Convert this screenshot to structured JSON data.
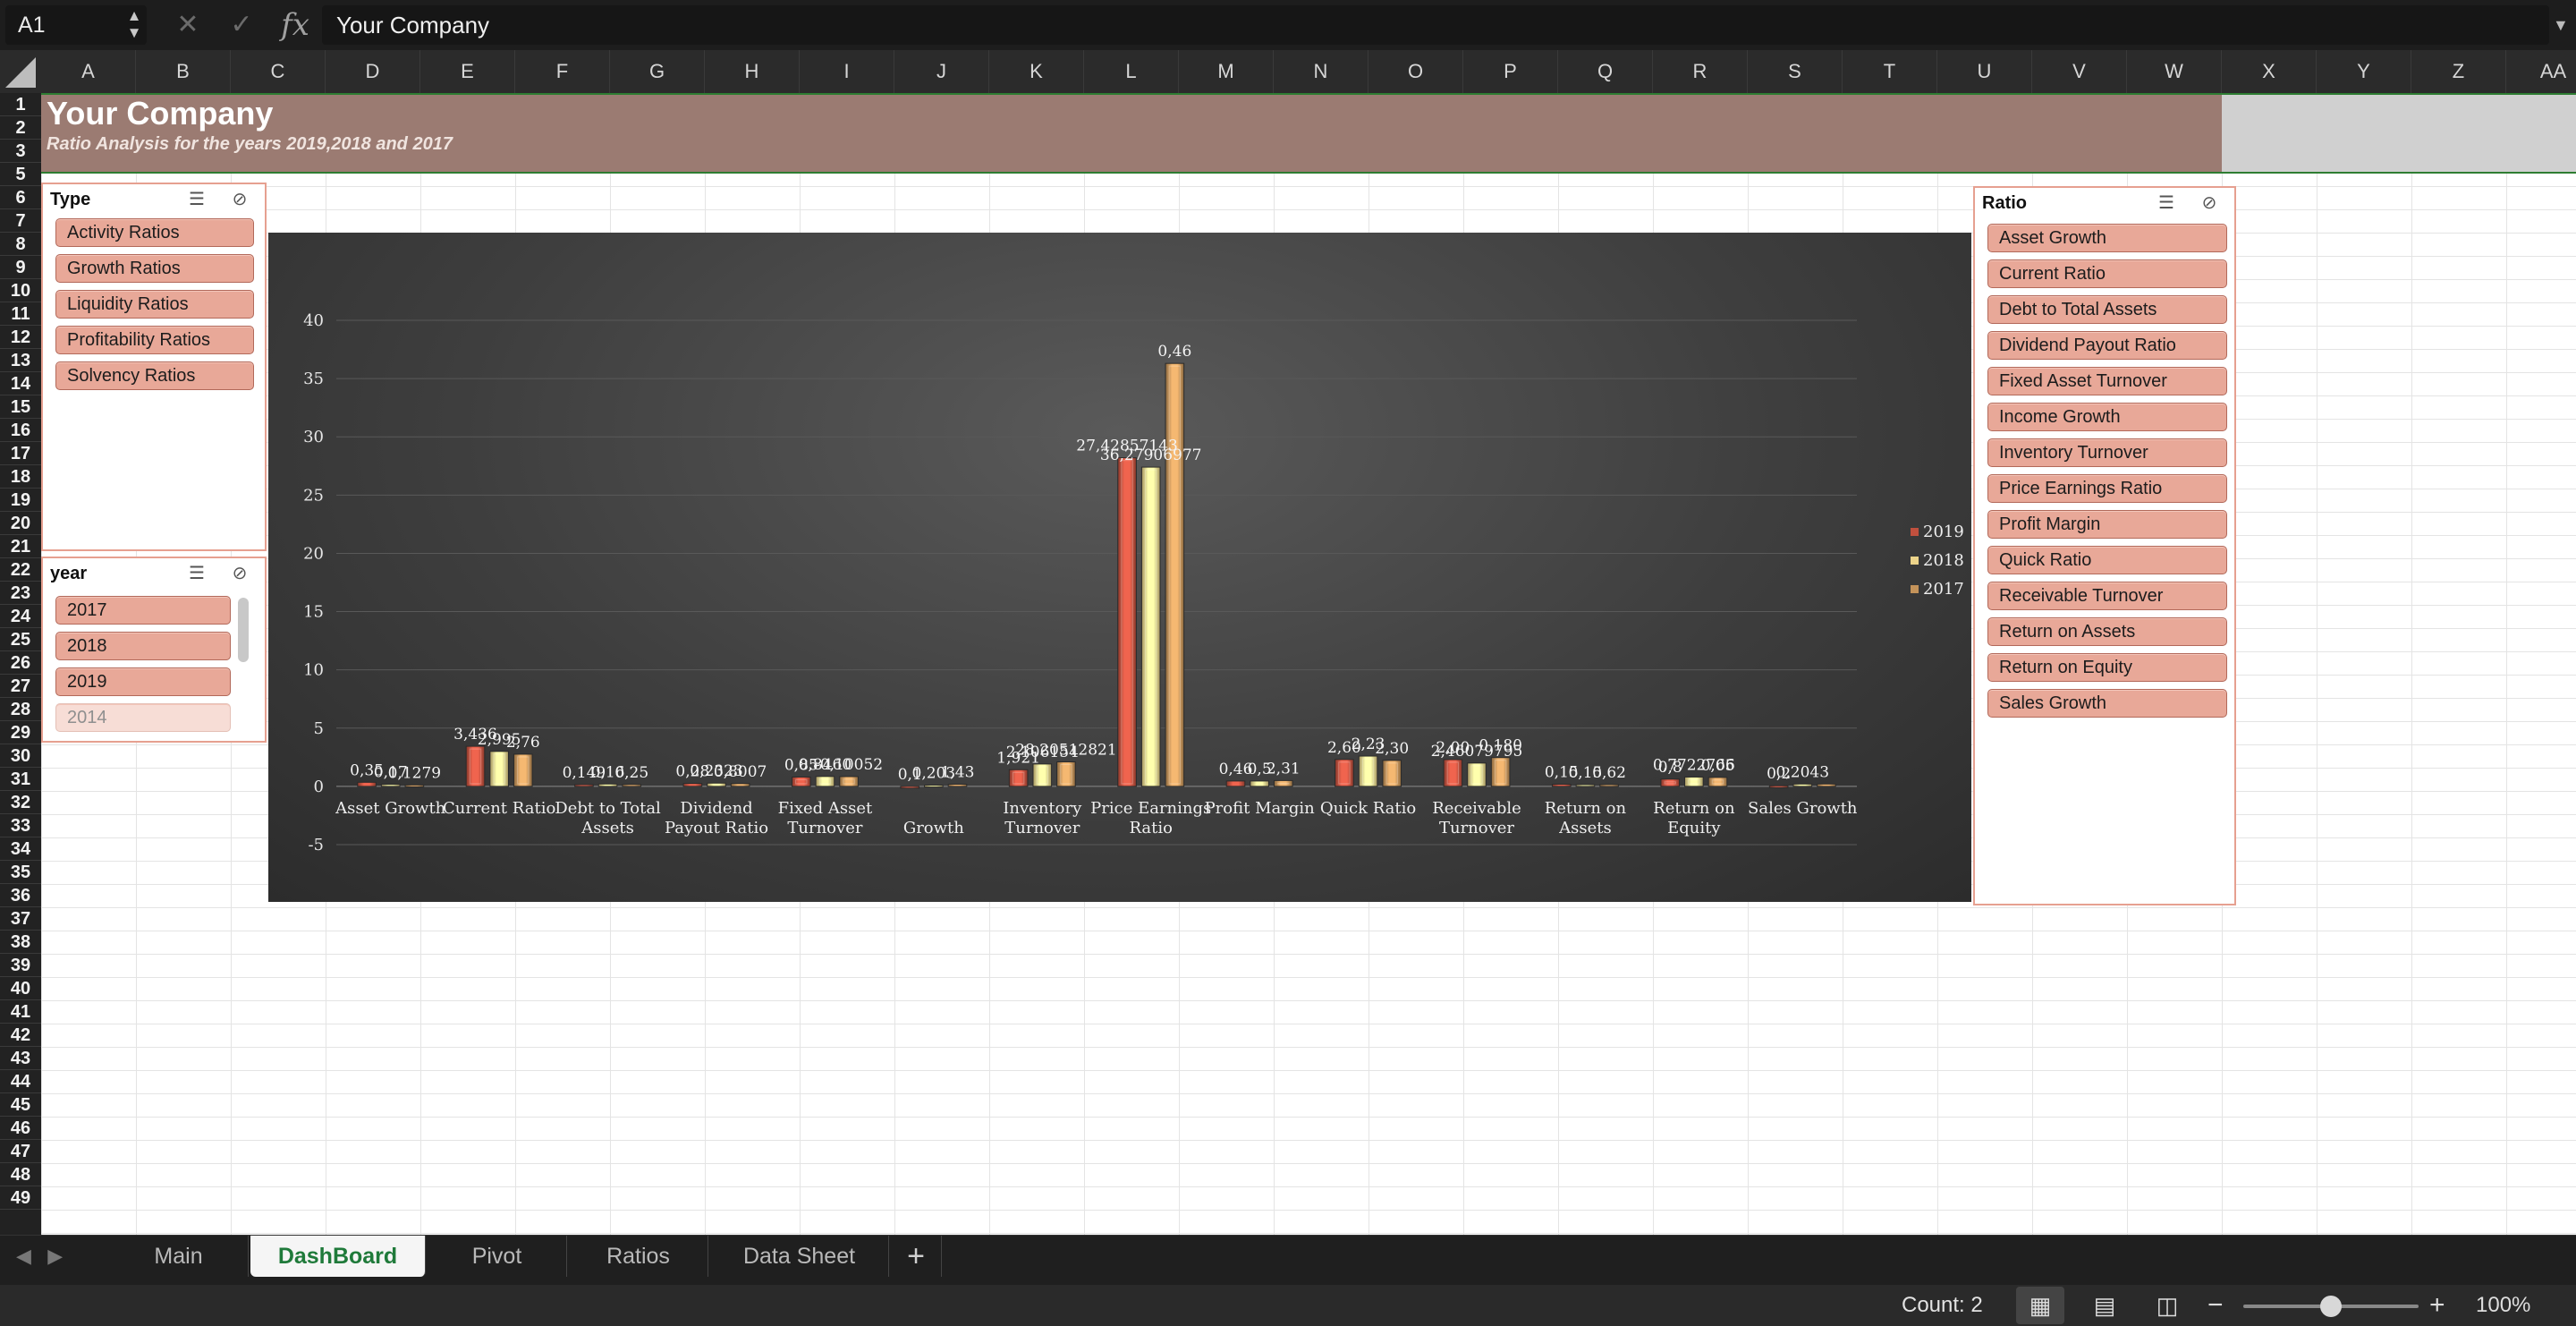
{
  "formula_bar": {
    "name_box": "A1",
    "content": "Your Company",
    "cancel_icon": "close-icon",
    "enter_icon": "checkmark-icon",
    "fx_label": "fx"
  },
  "columns": [
    "A",
    "B",
    "C",
    "D",
    "E",
    "F",
    "G",
    "H",
    "I",
    "J",
    "K",
    "L",
    "M",
    "N",
    "O",
    "P",
    "Q",
    "R",
    "S",
    "T",
    "U",
    "V",
    "W",
    "X",
    "Y",
    "Z",
    "AA"
  ],
  "rows": [
    1,
    2,
    3,
    5,
    6,
    7,
    8,
    9,
    10,
    11,
    12,
    13,
    14,
    15,
    16,
    17,
    18,
    19,
    20,
    21,
    22,
    23,
    24,
    25,
    26,
    27,
    28,
    29,
    30,
    31,
    32,
    33,
    34,
    35,
    36,
    37,
    38,
    39,
    40,
    41,
    42,
    43,
    44,
    45,
    46,
    47,
    48,
    49
  ],
  "title": {
    "company": "Your Company",
    "subtitle": "Ratio Analysis for the years 2019,2018 and 2017"
  },
  "slicers": {
    "type": {
      "title": "Type",
      "items": [
        "Activity Ratios",
        "Growth Ratios",
        "Liquidity Ratios",
        "Profitability Ratios",
        "Solvency Ratios"
      ]
    },
    "year": {
      "title": "year",
      "items": [
        "2017",
        "2018",
        "2019",
        "2014"
      ]
    },
    "ratio": {
      "title": "Ratio",
      "items": [
        "Asset Growth",
        "Current Ratio",
        "Debt to Total Assets",
        "Dividend Payout Ratio",
        "Fixed Asset Turnover",
        "Income Growth",
        "Inventory Turnover",
        "Price Earnings Ratio",
        "Profit Margin",
        "Quick Ratio",
        "Receivable Turnover",
        "Return on Assets",
        "Return on Equity",
        "Sales Growth"
      ]
    }
  },
  "chart_data": {
    "type": "bar",
    "categories": [
      "Asset Growth",
      "Current Ratio",
      "Debt to Total Assets",
      "Dividend Payout Ratio",
      "Fixed Asset Turnover",
      "Income Growth",
      "Inventory Turnover",
      "Price Earnings Ratio",
      "Profit Margin",
      "Quick Ratio",
      "Receivable Turnover",
      "Return on Assets",
      "Return on Equity",
      "Sales Growth"
    ],
    "category_lines": [
      [
        "Asset Growth"
      ],
      [
        "Current Ratio"
      ],
      [
        "Debt to Total",
        "Assets"
      ],
      [
        "Dividend",
        "Payout Ratio"
      ],
      [
        "Fixed Asset",
        "Turnover"
      ],
      [
        "",
        "Growth"
      ],
      [
        "Inventory",
        "Turnover"
      ],
      [
        "Price Earnings",
        "Ratio"
      ],
      [
        "Profit Margin"
      ],
      [
        "Quick Ratio"
      ],
      [
        "Receivable",
        "Turnover"
      ],
      [
        "Return on",
        "Assets"
      ],
      [
        "Return on",
        "Equity"
      ],
      [
        "Sales Growth"
      ]
    ],
    "series": [
      {
        "name": "2019",
        "color": "#c0503e",
        "values": [
          0.35,
          3.44,
          0.15,
          0.25,
          0.8,
          -0.1,
          1.43,
          28.2,
          0.46,
          2.31,
          2.3,
          0.18,
          0.62,
          0.05
        ]
      },
      {
        "name": "2018",
        "color": "#ecd38a",
        "values": [
          0.17,
          3.0,
          0.2,
          0.28,
          0.85,
          0.1,
          1.92,
          27.4,
          0.46,
          2.6,
          2.0,
          0.15,
          0.8,
          0.2
        ]
      },
      {
        "name": "2017",
        "color": "#c4935a",
        "values": [
          0.12,
          2.76,
          0.16,
          0.24,
          0.84,
          0.18,
          2.1,
          36.3,
          0.5,
          2.23,
          2.47,
          0.15,
          0.77,
          0.2
        ]
      }
    ],
    "data_labels": [
      "0,35",
      "0,17",
      "0,1279",
      "3,436",
      "2,995",
      "2,76",
      "0,149",
      "0,16",
      "0,25",
      "0,28",
      "0,2323",
      "0,8007",
      "0,85",
      "0,8460",
      "-0,10052",
      "0,1",
      "0,203",
      "1,43",
      "1,921",
      "2,106154",
      "28,20512821",
      "27,42857143",
      "36,27906977",
      "0,46",
      "0,46",
      "0,5",
      "2,31",
      "2,60",
      "2,23",
      "2,30",
      "2,00",
      "2,46079795",
      "0,180",
      "0,15",
      "0,15",
      "0,62",
      "0,8",
      "0,7722766",
      "0,05",
      "0,2",
      "0,2043"
    ],
    "yticks": [
      -5,
      0,
      5,
      10,
      15,
      20,
      25,
      30,
      35,
      40
    ],
    "ylim": [
      -5,
      40
    ],
    "legend_position": "right",
    "grid": true
  },
  "sheet_tabs": [
    "Main",
    "DashBoard",
    "Pivot",
    "Ratios",
    "Data Sheet"
  ],
  "active_tab": "DashBoard",
  "add_sheet_label": "+",
  "status": {
    "count": "Count: 2",
    "zoom": "100%",
    "zoom_fraction": 0.5
  }
}
